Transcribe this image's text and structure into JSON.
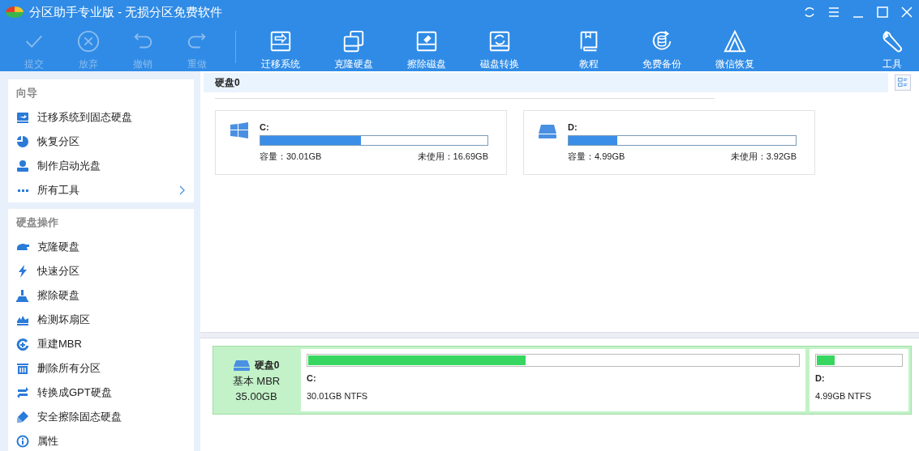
{
  "window": {
    "title": "分区助手专业版 - 无损分区免费软件"
  },
  "toolbar": [
    {
      "label": "提交",
      "disabled": true
    },
    {
      "label": "放弃",
      "disabled": true
    },
    {
      "label": "撤销",
      "disabled": true
    },
    {
      "label": "重做",
      "disabled": true
    },
    {
      "label": "迁移系统",
      "disabled": false
    },
    {
      "label": "克隆硬盘",
      "disabled": false
    },
    {
      "label": "擦除磁盘",
      "disabled": false
    },
    {
      "label": "磁盘转换",
      "disabled": false
    },
    {
      "label": "教程",
      "disabled": false
    },
    {
      "label": "免费备份",
      "disabled": false
    },
    {
      "label": "微信恢复",
      "disabled": false
    },
    {
      "label": "工具",
      "disabled": false
    }
  ],
  "sidebar": {
    "sections": [
      {
        "title": "向导",
        "items": [
          {
            "label": "迁移系统到固态硬盘"
          },
          {
            "label": "恢复分区"
          },
          {
            "label": "制作启动光盘"
          },
          {
            "label": "所有工具",
            "expandable": true
          }
        ]
      },
      {
        "title": "硬盘操作",
        "items": [
          {
            "label": "克隆硬盘"
          },
          {
            "label": "快速分区"
          },
          {
            "label": "擦除硬盘"
          },
          {
            "label": "检测坏扇区"
          },
          {
            "label": "重建MBR"
          },
          {
            "label": "删除所有分区"
          },
          {
            "label": "转换成GPT硬盘"
          },
          {
            "label": "安全擦除固态硬盘"
          },
          {
            "label": "属性"
          }
        ]
      }
    ]
  },
  "disk_header": {
    "title": "硬盘0"
  },
  "volumes": [
    {
      "kind": "system",
      "name": "C:",
      "level": 0.444,
      "capacity": "容量：30.01GB",
      "free": "未使用：16.69GB"
    },
    {
      "kind": "data",
      "name": "D:",
      "level": 0.215,
      "capacity": "容量：4.99GB",
      "free": "未使用：3.92GB"
    }
  ],
  "disk_map": {
    "name": "硬盘0",
    "type": "基本 MBR",
    "size": "35.00GB",
    "partitions": [
      {
        "name": "C:",
        "level": 0.444,
        "info": "30.01GB NTFS"
      },
      {
        "name": "D:",
        "level": 0.215,
        "info": "4.99GB NTFS"
      }
    ]
  }
}
